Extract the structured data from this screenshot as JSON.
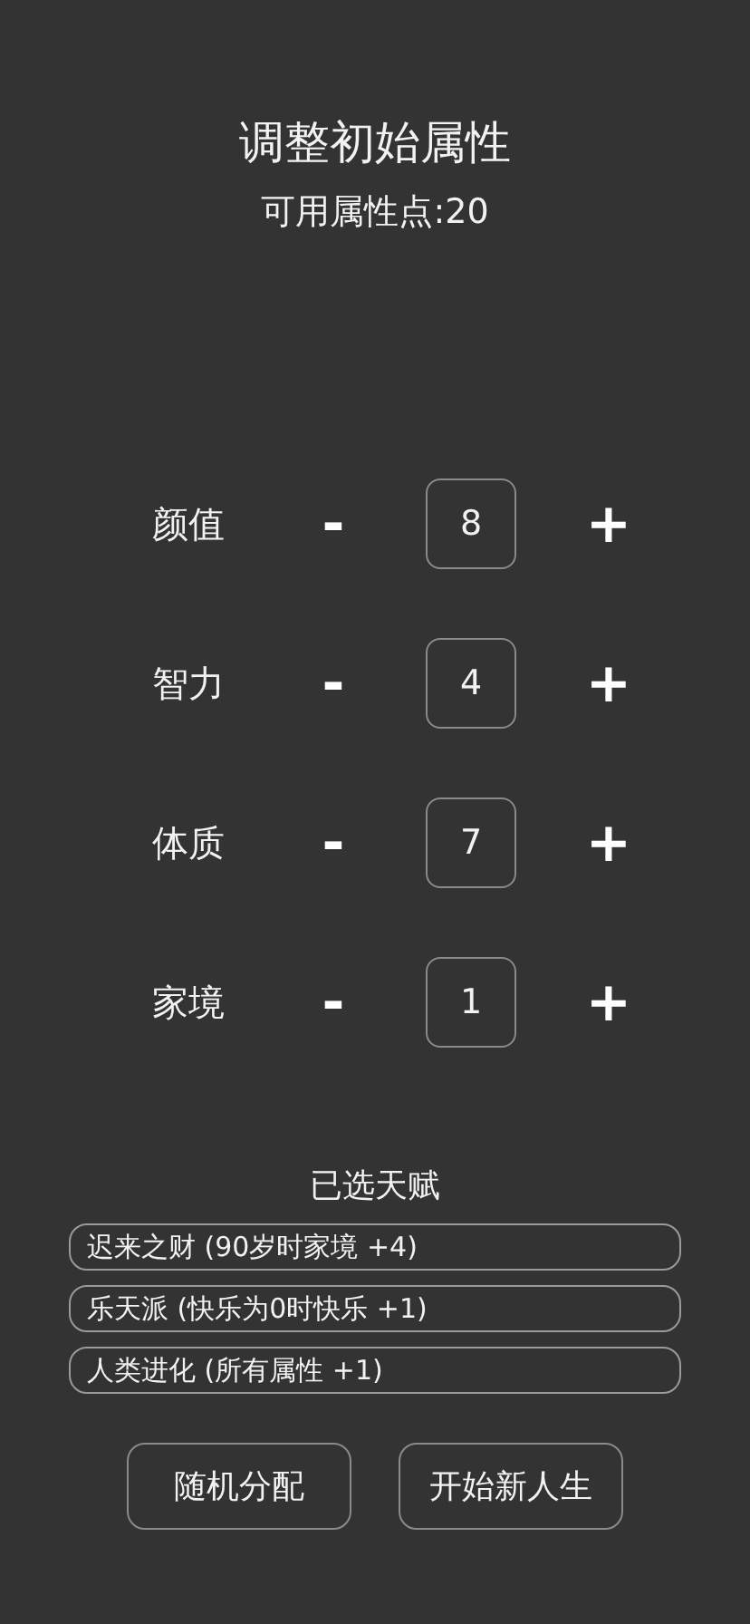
{
  "title": "调整初始属性",
  "points": "可用属性点:20",
  "attributes": [
    {
      "name": "颜值",
      "decrease": "-",
      "value": "8",
      "increase": "+"
    },
    {
      "name": "智力",
      "decrease": "-",
      "value": "4",
      "increase": "+"
    },
    {
      "name": "体质",
      "decrease": "-",
      "value": "7",
      "increase": "+"
    },
    {
      "name": "家境",
      "decrease": "-",
      "value": "1",
      "increase": "+"
    }
  ],
  "talents_heading": "已选天赋",
  "talents": [
    "迟来之财 (90岁时家境 +4)",
    "乐天派 (快乐为0时快乐 +1)",
    "人类进化 (所有属性 +1)"
  ],
  "buttons": [
    "随机分配",
    "开始新人生"
  ]
}
